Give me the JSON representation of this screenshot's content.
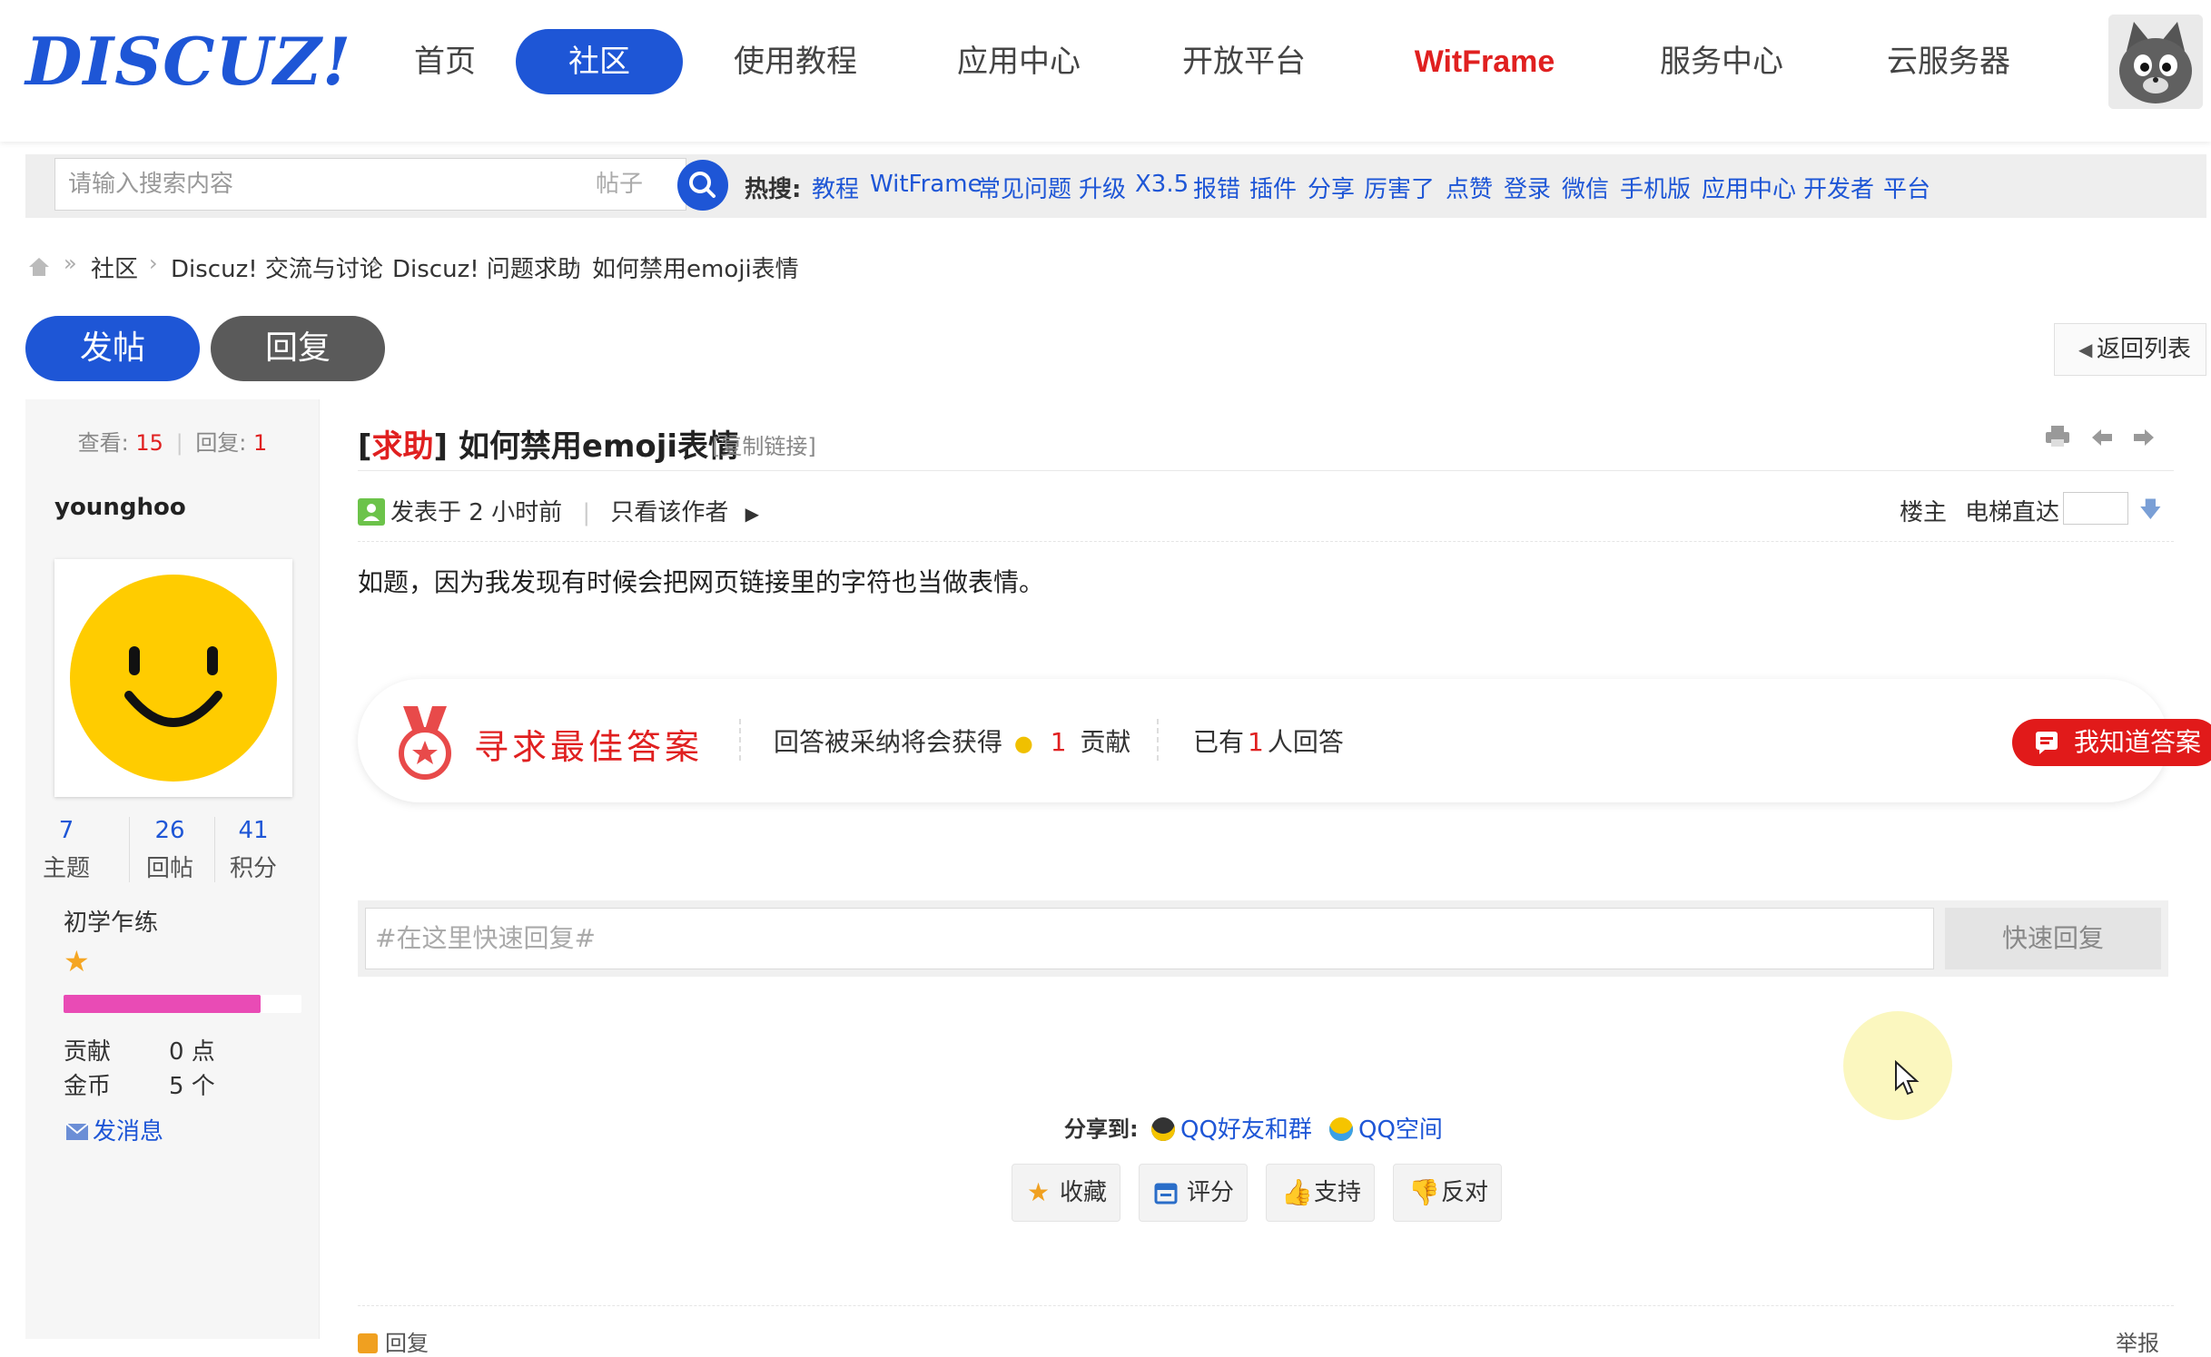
{
  "nav": {
    "logo": "DISCUZ!",
    "items": [
      "首页",
      "社区",
      "使用教程",
      "应用中心",
      "开放平台",
      "WitFrame",
      "服务中心",
      "云服务器"
    ],
    "active": "社区"
  },
  "search": {
    "placeholder": "请输入搜索内容",
    "type": "帖子",
    "hot_label": "热搜:",
    "hot_terms": [
      "教程",
      "WitFrame",
      "常见问题",
      "升级",
      "X3.5",
      "报错",
      "插件",
      "分享",
      "厉害了",
      "点赞",
      "登录",
      "微信",
      "手机版",
      "应用中心",
      "开发者",
      "平台"
    ]
  },
  "breadcrumb": [
    "社区",
    "Discuz! 交流与讨论",
    "Discuz! 问题求助",
    "如何禁用emoji表情"
  ],
  "actions": {
    "post": "发帖",
    "reply": "回复",
    "back": "返回列表"
  },
  "stats": {
    "views_label": "查看:",
    "views": "15",
    "replies_label": "回复:",
    "replies": "1"
  },
  "author": {
    "name": "younghoo",
    "threads": "7",
    "threads_label": "主题",
    "posts": "26",
    "posts_label": "回帖",
    "credits": "41",
    "credits_label": "积分",
    "level": "初学乍练",
    "level_progress": 0.83,
    "contrib_label": "贡献",
    "contrib_value": "0 点",
    "gold_label": "金币",
    "gold_value": "5 个",
    "send_message": "发消息"
  },
  "post": {
    "tag": "求助",
    "title": "如何禁用emoji表情",
    "copy_link": "[复制链接]",
    "posted_at": "发表于 2 小时前",
    "only_author": "只看该作者",
    "floor": "楼主",
    "elevator": "电梯直达",
    "body": "如题，因为我发现有时候会把网页链接里的字符也当做表情。"
  },
  "bounty": {
    "title": "寻求最佳答案",
    "reward_prefix": "回答被采纳将会获得",
    "reward_amount": "1",
    "reward_unit": "贡献",
    "answers_prefix": "已有",
    "answers_count": "1",
    "answers_suffix": "人回答",
    "button": "我知道答案"
  },
  "quick_reply": {
    "placeholder": "#在这里快速回复#",
    "button": "快速回复"
  },
  "share": {
    "label": "分享到:",
    "qq_friends": "QQ好友和群",
    "qq_zone": "QQ空间"
  },
  "post_actions": [
    "收藏",
    "评分",
    "支持",
    "反对"
  ],
  "footer": {
    "left": "回复",
    "right": "举报"
  },
  "colors": {
    "accent": "#1e56d6",
    "red": "#e02020",
    "level_bar": "#e94bb5"
  }
}
